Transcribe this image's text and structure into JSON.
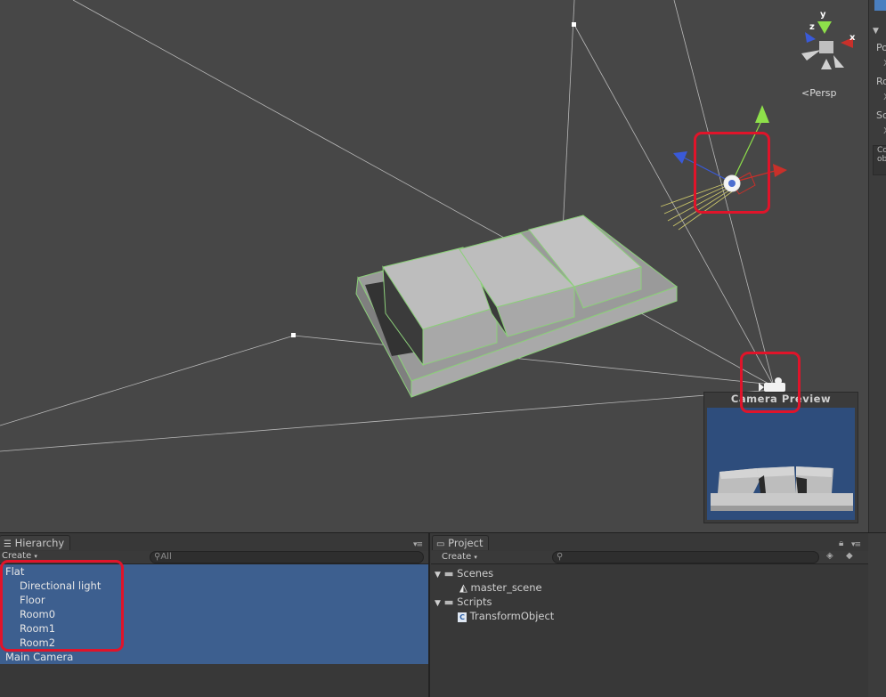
{
  "scene": {
    "camera_preview_title": "Camera Preview",
    "projection_label": "Persp",
    "gizmo_axes": {
      "x": "x",
      "y": "y",
      "z": "z"
    }
  },
  "inspector_strip": {
    "labels": [
      "Po",
      "Ro",
      "Sc"
    ],
    "axis_letter": "X",
    "component_label_1": "Co",
    "component_label_2": "ob"
  },
  "hierarchy": {
    "tab_label": "Hierarchy",
    "create_label": "Create",
    "search_placeholder": "All",
    "items": [
      {
        "label": "Flat"
      },
      {
        "label": "Directional light"
      },
      {
        "label": "Floor"
      },
      {
        "label": "Room0"
      },
      {
        "label": "Room1"
      },
      {
        "label": "Room2"
      },
      {
        "label": "Main Camera"
      }
    ]
  },
  "project": {
    "tab_label": "Project",
    "create_label": "Create",
    "folders": [
      {
        "label": "Scenes",
        "children": [
          {
            "label": "master_scene"
          }
        ]
      },
      {
        "label": "Scripts",
        "children": [
          {
            "label": "TransformObject"
          }
        ]
      }
    ]
  },
  "colors": {
    "selection": "#3d5f8f",
    "highlight_box": "#e0142a",
    "scene_bg": "#474747",
    "preview_sky": "#2e4d7c"
  }
}
